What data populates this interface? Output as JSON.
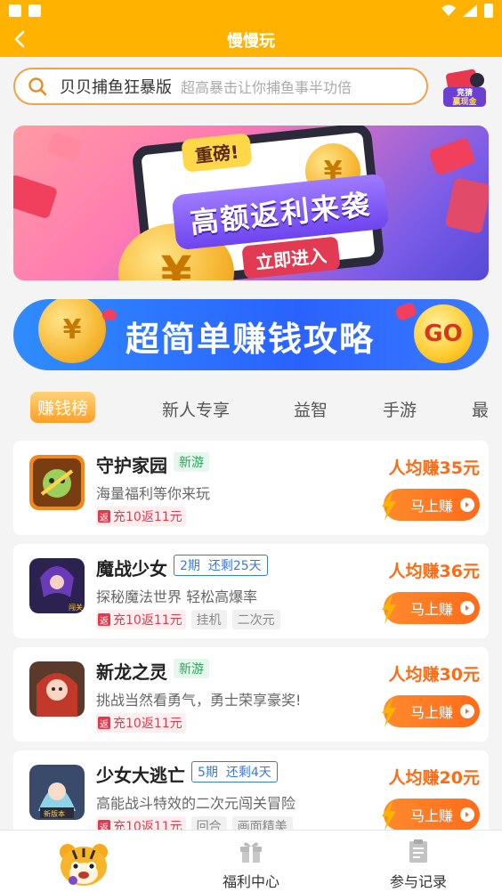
{
  "header": {
    "title": "慢慢玩"
  },
  "search": {
    "keyword": "贝贝捕鱼狂暴版",
    "hint": "超高暴击让你捕鱼事半功倍"
  },
  "gift_badge": {
    "text_line1": "竞猜",
    "text_line2": "赢现金"
  },
  "banner": {
    "tag": "重磅!",
    "headline": "高额返利来袭",
    "cta": "立即进入",
    "coin_symbol": "¥"
  },
  "strategy": {
    "text": "超简单赚钱攻略",
    "go": "GO",
    "coin_symbol": "¥"
  },
  "tabs": [
    {
      "label": "赚钱榜",
      "active": true
    },
    {
      "label": "新人专享"
    },
    {
      "label": "益智"
    },
    {
      "label": "手游"
    },
    {
      "label": "最"
    }
  ],
  "games": [
    {
      "title": "守护家园",
      "badge_new": "新游",
      "desc": "海量福利等你来玩",
      "rebate_mark": "返",
      "rebate": "充10返11元",
      "tags": [],
      "earn": "人均赚35元",
      "button": "马上赚"
    },
    {
      "title": "魔战少女",
      "period": "2期",
      "remaining": "还剩25天",
      "desc": "探秘魔法世界 轻松高爆率",
      "rebate_mark": "返",
      "rebate": "充10返11元",
      "tags": [
        "挂机",
        "二次元"
      ],
      "earn": "人均赚36元",
      "button": "马上赚",
      "icon_label": "闯关"
    },
    {
      "title": "新龙之灵",
      "badge_new": "新游",
      "desc": "挑战当然看勇气，勇士荣享豪奖!",
      "rebate_mark": "返",
      "rebate": "充10返11元",
      "tags": [],
      "earn": "人均赚30元",
      "button": "马上赚"
    },
    {
      "title": "少女大逃亡",
      "period": "5期",
      "remaining": "还剩4天",
      "desc": "高能战斗特效的二次元闯关冒险",
      "rebate_mark": "返",
      "rebate": "充10返11元",
      "tags": [
        "回合",
        "画面精美"
      ],
      "earn": "人均赚20元",
      "button": "马上赚",
      "icon_label": "新版本"
    }
  ],
  "bottom_nav": [
    {
      "label": ""
    },
    {
      "label": "福利中心"
    },
    {
      "label": "参与记录"
    }
  ],
  "colors": {
    "brand": "#ffb300",
    "accent": "#ff6a13",
    "rebate": "#e2394c",
    "new": "#2fa45a",
    "period": "#3b79d8"
  }
}
